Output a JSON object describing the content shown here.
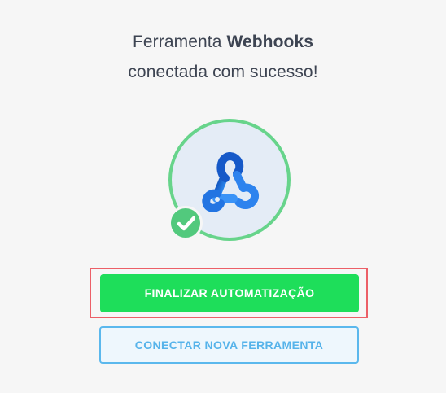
{
  "header": {
    "line1_prefix": "Ferramenta ",
    "line1_tool": "Webhooks",
    "line2": "conectada com sucesso!"
  },
  "status_icon": {
    "tool_icon": "webhook-icon",
    "badge_icon": "check-icon"
  },
  "colors": {
    "primary_button": "#1ede5a",
    "secondary_button_text": "#56b3ea",
    "ring": "#67d48b",
    "highlight": "#ec5f67"
  },
  "actions": {
    "finalize_label": "FINALIZAR AUTOMATIZAÇÃO",
    "connect_new_label": "CONECTAR NOVA FERRAMENTA"
  }
}
